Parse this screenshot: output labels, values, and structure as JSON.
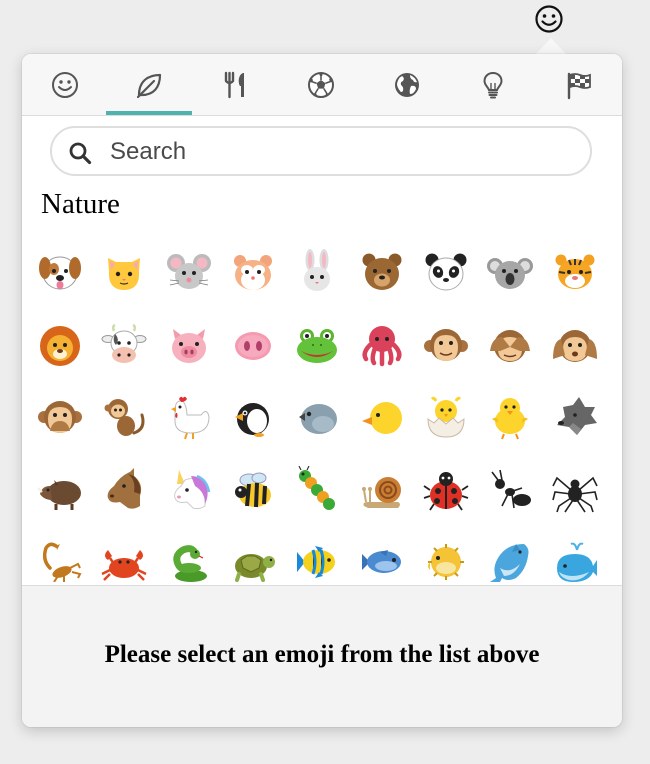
{
  "trigger": {
    "icon": "smiley-face-icon"
  },
  "tabs": [
    {
      "name": "people",
      "icon": "smiley-icon",
      "active": false
    },
    {
      "name": "nature",
      "icon": "leaf-icon",
      "active": true
    },
    {
      "name": "food",
      "icon": "fork-knife-icon",
      "active": false
    },
    {
      "name": "activity",
      "icon": "soccer-ball-icon",
      "active": false
    },
    {
      "name": "places",
      "icon": "globe-icon",
      "active": false
    },
    {
      "name": "objects",
      "icon": "lightbulb-icon",
      "active": false
    },
    {
      "name": "flags",
      "icon": "checkered-flag-icon",
      "active": false
    }
  ],
  "search": {
    "placeholder": "Search",
    "value": ""
  },
  "section": {
    "title": "Nature"
  },
  "emojis": [
    "dog-face",
    "cat-face",
    "mouse-face",
    "hamster-face",
    "rabbit-face",
    "bear-face",
    "panda-face",
    "koala-face",
    "tiger-face",
    "lion-face",
    "cow-face",
    "pig-face",
    "pig-nose",
    "frog-face",
    "octopus",
    "monkey-face",
    "see-no-evil-monkey",
    "hear-no-evil-monkey",
    "speak-no-evil-monkey",
    "monkey",
    "chicken",
    "penguin",
    "bird",
    "baby-chick-head",
    "hatching-chick",
    "front-facing-baby-chick",
    "wolf-face",
    "boar",
    "horse-face",
    "unicorn-face",
    "honeybee",
    "bug",
    "snail",
    "lady-beetle",
    "ant",
    "spider",
    "scorpion",
    "crab",
    "snake",
    "turtle",
    "tropical-fish",
    "fish",
    "blowfish",
    "dolphin",
    "spouting-whale"
  ],
  "footer": {
    "message": "Please select an emoji from the list above"
  },
  "colors": {
    "accent": "#4fb3ad",
    "footer_bg": "#f3f3f3",
    "tab_bar_bg": "#f7f7f7"
  }
}
